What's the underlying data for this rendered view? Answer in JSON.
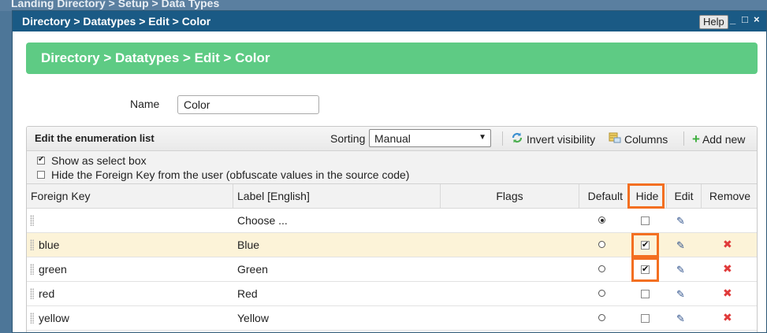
{
  "background": {
    "title": "Landing Directory > Setup > Data Types"
  },
  "window": {
    "title": "Directory > Datatypes > Edit > Color",
    "help_label": "Help",
    "minimize": "_",
    "maximize": "□",
    "close": "×"
  },
  "header": {
    "breadcrumb": "Directory > Datatypes > Edit > Color"
  },
  "form": {
    "name_label": "Name",
    "name_value": "Color"
  },
  "panel": {
    "title": "Edit the enumeration list",
    "sorting_label": "Sorting",
    "sorting_value": "Manual",
    "invert_label": "Invert visibility",
    "columns_label": "Columns",
    "add_label": "Add new"
  },
  "options": [
    {
      "label": "Show as select box",
      "checked": true
    },
    {
      "label": "Hide the Foreign Key from the user (obfuscate values in the source code)",
      "checked": false
    }
  ],
  "table": {
    "columns": [
      "Foreign Key",
      "Label [English]",
      "Flags",
      "Default",
      "Hide",
      "Edit",
      "Remove"
    ],
    "rows": [
      {
        "key": "",
        "label": "Choose ...",
        "default": true,
        "hide": false,
        "removable": false
      },
      {
        "key": "blue",
        "label": "Blue",
        "default": false,
        "hide": true,
        "removable": true
      },
      {
        "key": "green",
        "label": "Green",
        "default": false,
        "hide": true,
        "removable": true
      },
      {
        "key": "red",
        "label": "Red",
        "default": false,
        "hide": false,
        "removable": true
      },
      {
        "key": "yellow",
        "label": "Yellow",
        "default": false,
        "hide": false,
        "removable": true
      }
    ]
  },
  "colors": {
    "titlebar": "#1a5a85",
    "header_bar": "#5ecb84",
    "highlight": "#f36f21",
    "selected_row": "#fcf3d8"
  }
}
